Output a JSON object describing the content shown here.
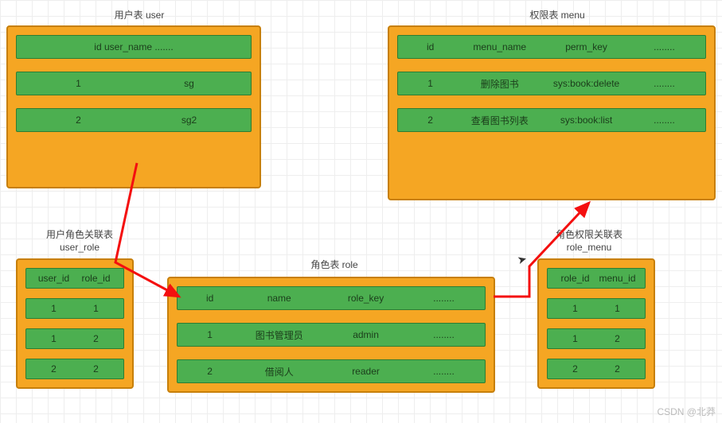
{
  "colors": {
    "table_fill": "#f5a623",
    "table_border": "#c77f0a",
    "row_fill": "#4caf50",
    "arrow": "#f40f0f"
  },
  "watermark": "CSDN @北莽",
  "tables": {
    "user": {
      "title": "用户表   user",
      "header_single": "id user_name .......",
      "rows": [
        {
          "id": "1",
          "name": "sg"
        },
        {
          "id": "2",
          "name": "sg2"
        }
      ]
    },
    "menu": {
      "title": "权限表   menu",
      "header": [
        "id",
        "menu_name",
        "perm_key",
        "........"
      ],
      "rows": [
        {
          "id": "1",
          "name": "删除图书",
          "perm": "sys:book:delete",
          "extra": "........"
        },
        {
          "id": "2",
          "name": "查看图书列表",
          "perm": "sys:book:list",
          "extra": "........"
        }
      ]
    },
    "user_role": {
      "title_line1": "用户角色关联表",
      "title_line2": "user_role",
      "header": [
        "user_id",
        "role_id"
      ],
      "rows": [
        {
          "a": "1",
          "b": "1"
        },
        {
          "a": "1",
          "b": "2"
        },
        {
          "a": "2",
          "b": "2"
        }
      ]
    },
    "role": {
      "title": "角色表   role",
      "header": [
        "id",
        "name",
        "role_key",
        "........"
      ],
      "rows": [
        {
          "id": "1",
          "name": "图书管理员",
          "key": "admin",
          "extra": "........"
        },
        {
          "id": "2",
          "name": "借阅人",
          "key": "reader",
          "extra": "........"
        }
      ]
    },
    "role_menu": {
      "title_line1": "角色权限关联表",
      "title_line2": "role_menu",
      "header": [
        "role_id",
        "menu_id"
      ],
      "rows": [
        {
          "a": "1",
          "b": "1"
        },
        {
          "a": "1",
          "b": "2"
        },
        {
          "a": "2",
          "b": "2"
        }
      ]
    }
  }
}
